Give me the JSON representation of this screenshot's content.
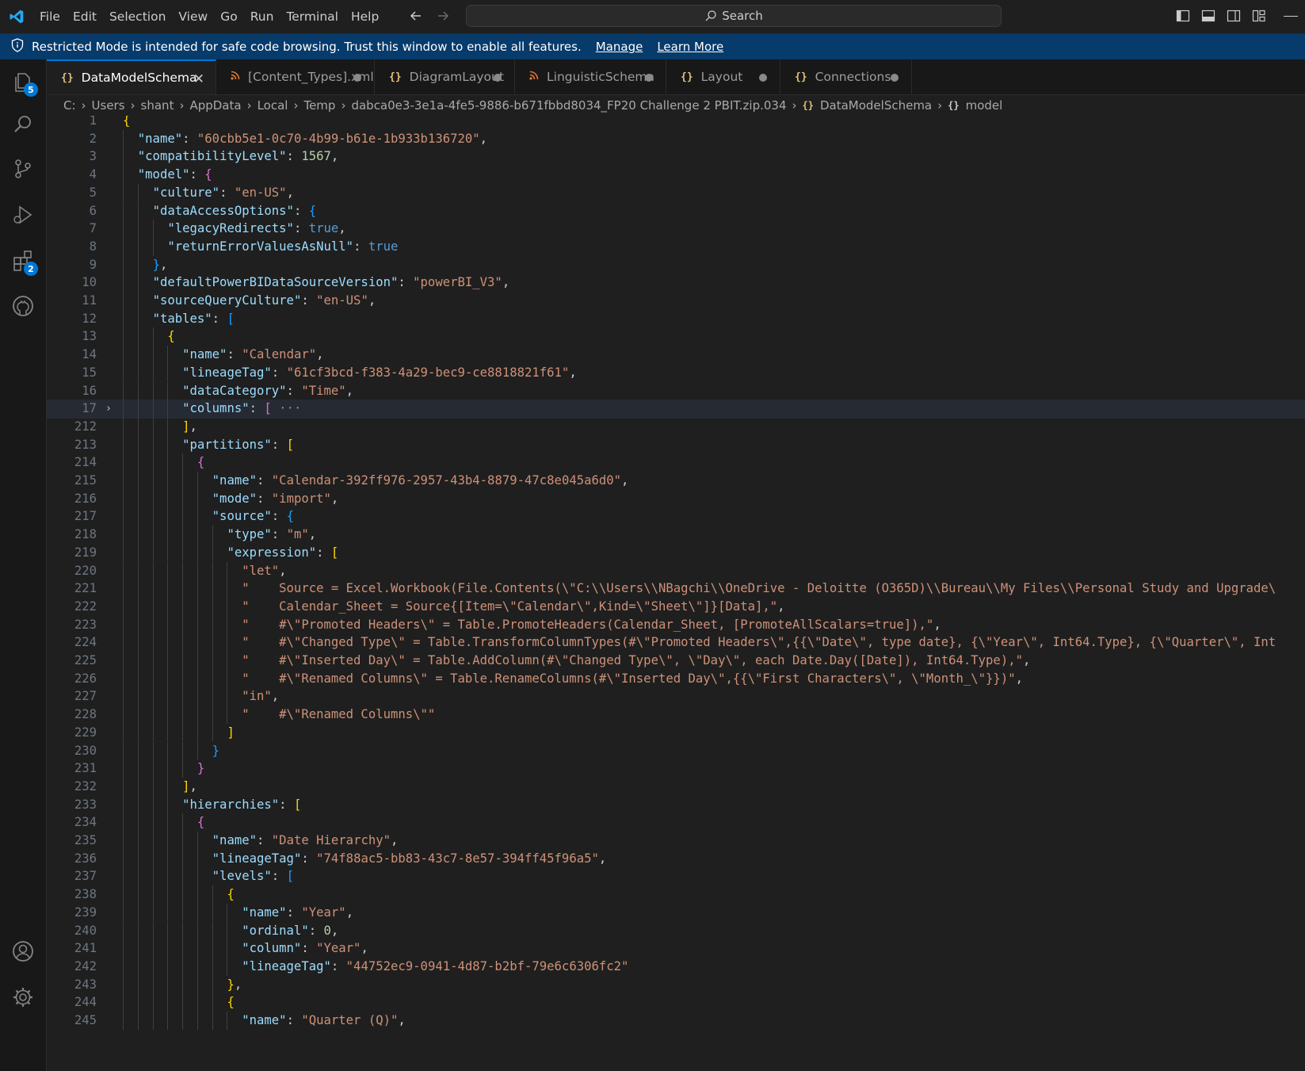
{
  "menu": [
    "File",
    "Edit",
    "Selection",
    "View",
    "Go",
    "Run",
    "Terminal",
    "Help"
  ],
  "search": {
    "label": "Search"
  },
  "banner": {
    "message": "Restricted Mode is intended for safe code browsing. Trust this window to enable all features.",
    "manage": "Manage",
    "learn_more": "Learn More"
  },
  "activity_bar": {
    "explorer_badge": "5",
    "extensions_badge": "2"
  },
  "tabs": [
    {
      "label": "DataModelSchema",
      "icon": "{}",
      "active": true
    },
    {
      "label": "[Content_Types].xml",
      "icon": "rss",
      "active": false
    },
    {
      "label": "DiagramLayout",
      "icon": "{}",
      "active": false
    },
    {
      "label": "LinguisticSchema",
      "icon": "rss",
      "active": false
    },
    {
      "label": "Layout",
      "icon": "{}",
      "active": false
    },
    {
      "label": "Connections",
      "icon": "{}",
      "active": false
    }
  ],
  "breadcrumb": [
    "C:",
    "Users",
    "shant",
    "AppData",
    "Local",
    "Temp",
    "dabca0e3-3e1a-4fe5-9886-b671fbbd8034_FP20 Challenge 2 PBIT.zip.034",
    "DataModelSchema",
    "model"
  ],
  "breadcrumb_icons": {
    "json": "{}",
    "object": "{}"
  },
  "fold_ellipsis": "···",
  "lines": [
    {
      "n": "1",
      "t": "{"
    },
    {
      "n": "2",
      "t": "  \"name\": \"60cbb5e1-0c70-4b99-b61e-1b933b136720\","
    },
    {
      "n": "3",
      "t": "  \"compatibilityLevel\": 1567,"
    },
    {
      "n": "4",
      "t": "  \"model\": {"
    },
    {
      "n": "5",
      "t": "    \"culture\": \"en-US\","
    },
    {
      "n": "6",
      "t": "    \"dataAccessOptions\": {"
    },
    {
      "n": "7",
      "t": "      \"legacyRedirects\": true,"
    },
    {
      "n": "8",
      "t": "      \"returnErrorValuesAsNull\": true"
    },
    {
      "n": "9",
      "t": "    },"
    },
    {
      "n": "10",
      "t": "    \"defaultPowerBIDataSourceVersion\": \"powerBI_V3\","
    },
    {
      "n": "11",
      "t": "    \"sourceQueryCulture\": \"en-US\","
    },
    {
      "n": "12",
      "t": "    \"tables\": ["
    },
    {
      "n": "13",
      "t": "      {"
    },
    {
      "n": "14",
      "t": "        \"name\": \"Calendar\","
    },
    {
      "n": "15",
      "t": "        \"lineageTag\": \"61cf3bcd-f383-4a29-bec9-ce8818821f61\","
    },
    {
      "n": "16",
      "t": "        \"dataCategory\": \"Time\","
    },
    {
      "n": "17",
      "t": "        \"columns\": [",
      "folded": true
    },
    {
      "n": "212",
      "t": "        ],"
    },
    {
      "n": "213",
      "t": "        \"partitions\": ["
    },
    {
      "n": "214",
      "t": "          {"
    },
    {
      "n": "215",
      "t": "            \"name\": \"Calendar-392ff976-2957-43b4-8879-47c8e045a6d0\","
    },
    {
      "n": "216",
      "t": "            \"mode\": \"import\","
    },
    {
      "n": "217",
      "t": "            \"source\": {"
    },
    {
      "n": "218",
      "t": "              \"type\": \"m\","
    },
    {
      "n": "219",
      "t": "              \"expression\": ["
    },
    {
      "n": "220",
      "t": "                \"let\","
    },
    {
      "n": "221",
      "t": "                \"    Source = Excel.Workbook(File.Contents(\\\"C:\\\\Users\\\\NBagchi\\\\OneDrive - Deloitte (O365D)\\\\Bureau\\\\My Files\\\\Personal Study and Upgrade\\"
    },
    {
      "n": "222",
      "t": "                \"    Calendar_Sheet = Source{[Item=\\\"Calendar\\\",Kind=\\\"Sheet\\\"]}[Data],\","
    },
    {
      "n": "223",
      "t": "                \"    #\\\"Promoted Headers\\\" = Table.PromoteHeaders(Calendar_Sheet, [PromoteAllScalars=true]),\","
    },
    {
      "n": "224",
      "t": "                \"    #\\\"Changed Type\\\" = Table.TransformColumnTypes(#\\\"Promoted Headers\\\",{{\\\"Date\\\", type date}, {\\\"Year\\\", Int64.Type}, {\\\"Quarter\\\", Int"
    },
    {
      "n": "225",
      "t": "                \"    #\\\"Inserted Day\\\" = Table.AddColumn(#\\\"Changed Type\\\", \\\"Day\\\", each Date.Day([Date]), Int64.Type),\","
    },
    {
      "n": "226",
      "t": "                \"    #\\\"Renamed Columns\\\" = Table.RenameColumns(#\\\"Inserted Day\\\",{{\\\"First Characters\\\", \\\"Month_\\\"}})\","
    },
    {
      "n": "227",
      "t": "                \"in\","
    },
    {
      "n": "228",
      "t": "                \"    #\\\"Renamed Columns\\\"\""
    },
    {
      "n": "229",
      "t": "              ]"
    },
    {
      "n": "230",
      "t": "            }"
    },
    {
      "n": "231",
      "t": "          }"
    },
    {
      "n": "232",
      "t": "        ],"
    },
    {
      "n": "233",
      "t": "        \"hierarchies\": ["
    },
    {
      "n": "234",
      "t": "          {"
    },
    {
      "n": "235",
      "t": "            \"name\": \"Date Hierarchy\","
    },
    {
      "n": "236",
      "t": "            \"lineageTag\": \"74f88ac5-bb83-43c7-8e57-394ff45f96a5\","
    },
    {
      "n": "237",
      "t": "            \"levels\": ["
    },
    {
      "n": "238",
      "t": "              {"
    },
    {
      "n": "239",
      "t": "                \"name\": \"Year\","
    },
    {
      "n": "240",
      "t": "                \"ordinal\": 0,"
    },
    {
      "n": "241",
      "t": "                \"column\": \"Year\","
    },
    {
      "n": "242",
      "t": "                \"lineageTag\": \"44752ec9-0941-4d87-b2bf-79e6c6306fc2\""
    },
    {
      "n": "243",
      "t": "              },"
    },
    {
      "n": "244",
      "t": "              {"
    },
    {
      "n": "245",
      "t": "                \"name\": \"Quarter (Q)\","
    }
  ]
}
